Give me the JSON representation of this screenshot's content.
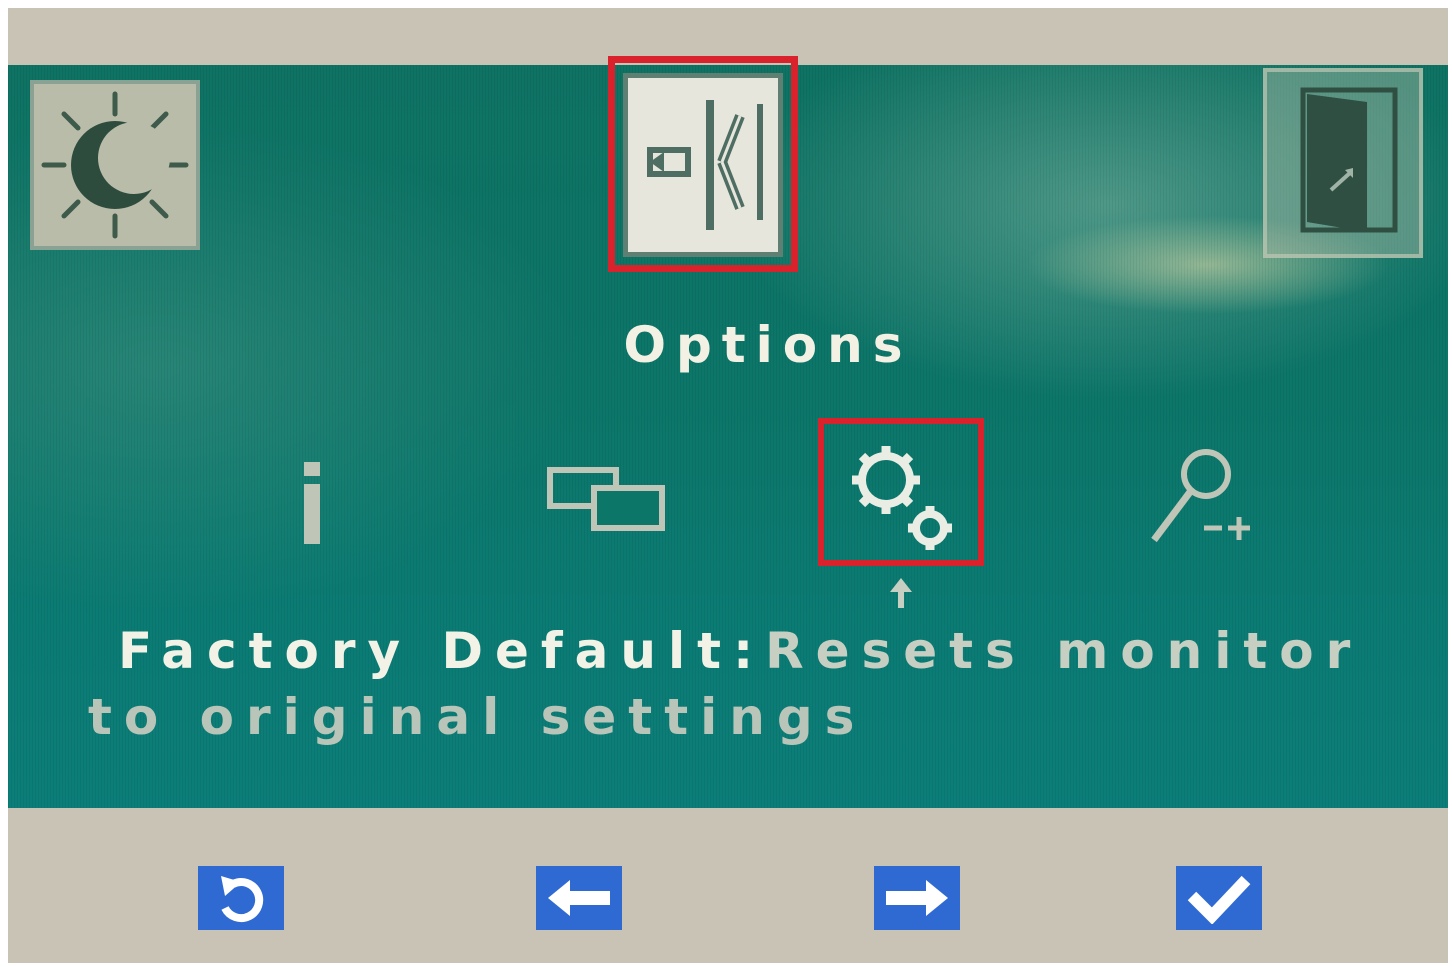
{
  "osd": {
    "menu_title": "Options",
    "top_menu": [
      {
        "name": "brightness-contrast",
        "icon": "sun-moon-icon",
        "selected": false
      },
      {
        "name": "options",
        "icon": "options-panel-icon",
        "selected": true
      },
      {
        "name": "exit",
        "icon": "door-exit-icon",
        "selected": false
      }
    ],
    "sub_menu": [
      {
        "name": "information",
        "icon": "info-icon",
        "selected": false
      },
      {
        "name": "display-settings",
        "icon": "dual-screen-icon",
        "selected": false
      },
      {
        "name": "factory-default",
        "icon": "gears-icon",
        "selected": true
      },
      {
        "name": "zoom",
        "icon": "magnifier-zoom-icon",
        "selected": false
      }
    ],
    "description": {
      "item_name": "Factory Default",
      "separator": ":",
      "text_line1": "Resets monitor",
      "text_line2": "to original settings"
    }
  },
  "buttons": [
    {
      "name": "back-button",
      "icon": "undo-icon"
    },
    {
      "name": "left-button",
      "icon": "arrow-left-icon"
    },
    {
      "name": "right-button",
      "icon": "arrow-right-icon"
    },
    {
      "name": "ok-button",
      "icon": "checkmark-icon"
    }
  ],
  "colors": {
    "screen_bg": "#0c7669",
    "highlight": "#d9222b",
    "button": "#2f6ad3",
    "bezel": "#c9c3b5"
  }
}
